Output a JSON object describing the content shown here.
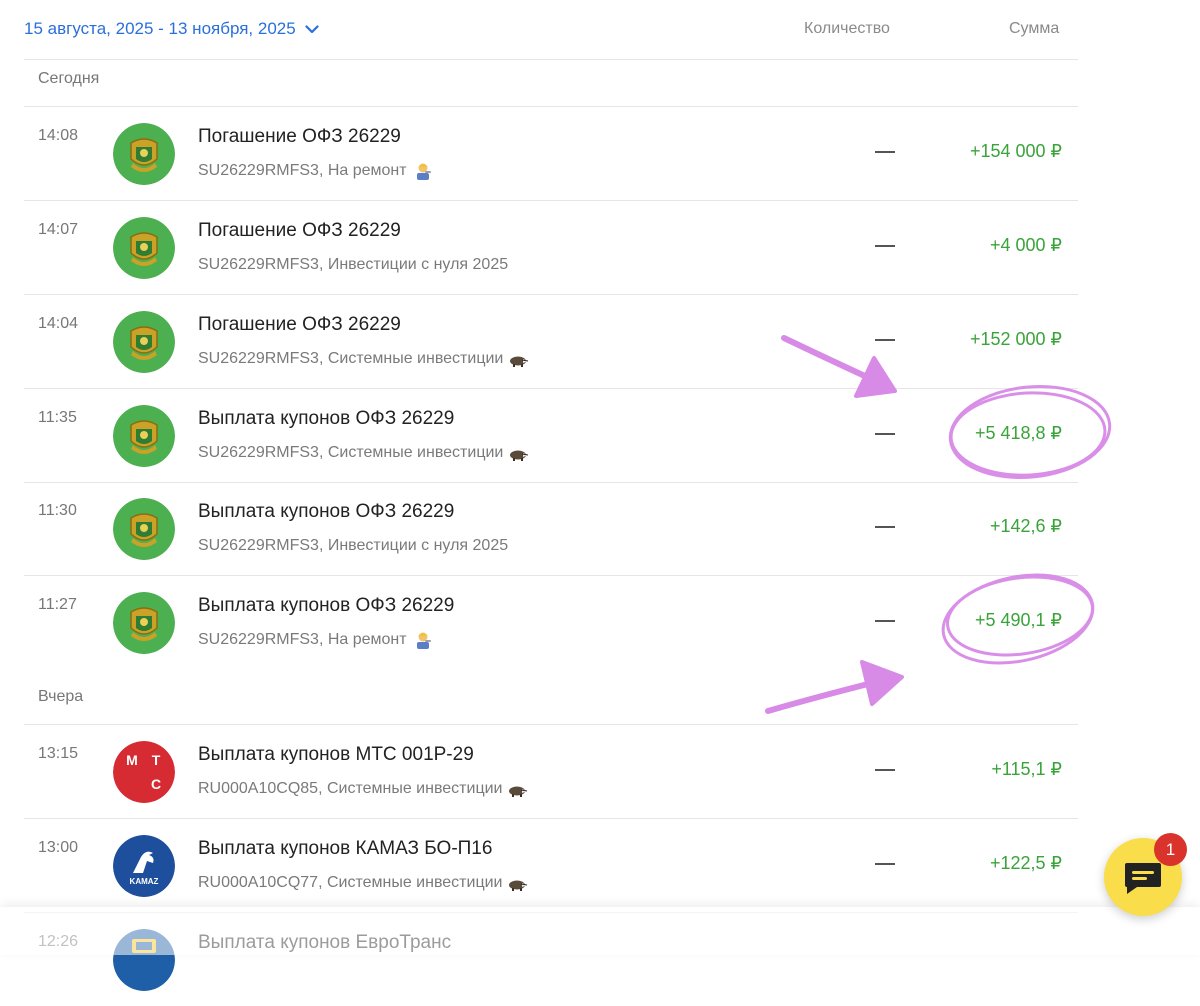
{
  "header": {
    "period": "15 августа, 2025 - 13 ноября, 2025",
    "col_quantity": "Количество",
    "col_sum": "Сумма"
  },
  "sections": [
    {
      "label": "Сегодня",
      "rows": [
        {
          "time": "14:08",
          "title": "Погашение ОФЗ 26229",
          "subtitle": "SU26229RMFS3, На ремонт",
          "emoji": "mechanic-emoji",
          "quantity": "—",
          "amount": "+154 000 ₽",
          "logo": "ofz-coat-of-arms-icon"
        },
        {
          "time": "14:07",
          "title": "Погашение ОФЗ 26229",
          "subtitle": "SU26229RMFS3, Инвестиции с нуля 2025",
          "emoji": "",
          "quantity": "—",
          "amount": "+4 000 ₽",
          "logo": "ofz-coat-of-arms-icon"
        },
        {
          "time": "14:04",
          "title": "Погашение ОФЗ 26229",
          "subtitle": "SU26229RMFS3, Системные инвестиции",
          "emoji": "badger-emoji",
          "quantity": "—",
          "amount": "+152 000 ₽",
          "logo": "ofz-coat-of-arms-icon"
        },
        {
          "time": "11:35",
          "title": "Выплата купонов ОФЗ 26229",
          "subtitle": "SU26229RMFS3, Системные инвестиции",
          "emoji": "badger-emoji",
          "quantity": "—",
          "amount": "+5 418,8 ₽",
          "logo": "ofz-coat-of-arms-icon"
        },
        {
          "time": "11:30",
          "title": "Выплата купонов ОФЗ 26229",
          "subtitle": "SU26229RMFS3, Инвестиции с нуля 2025",
          "emoji": "",
          "quantity": "—",
          "amount": "+142,6 ₽",
          "logo": "ofz-coat-of-arms-icon"
        },
        {
          "time": "11:27",
          "title": "Выплата купонов ОФЗ 26229",
          "subtitle": "SU26229RMFS3, На ремонт",
          "emoji": "mechanic-emoji",
          "quantity": "—",
          "amount": "+5 490,1 ₽",
          "logo": "ofz-coat-of-arms-icon"
        }
      ]
    },
    {
      "label": "Вчера",
      "rows": [
        {
          "time": "13:15",
          "title": "Выплата купонов МТС 001P-29",
          "subtitle": "RU000A10CQ85, Системные инвестиции",
          "emoji": "badger-emoji",
          "quantity": "—",
          "amount": "+115,1 ₽",
          "logo": "mts-logo-icon",
          "logo_text": [
            "М",
            "Т",
            "С"
          ]
        },
        {
          "time": "13:00",
          "title": "Выплата купонов КАМАЗ БО-П16",
          "subtitle": "RU000A10CQ77, Системные инвестиции",
          "emoji": "badger-emoji",
          "quantity": "—",
          "amount": "+122,5 ₽",
          "logo": "kamaz-logo-icon",
          "logo_text": "KAMAZ"
        },
        {
          "time": "12:26",
          "title": "Выплата купонов ЕвроТранс",
          "subtitle": "",
          "emoji": "",
          "quantity": "",
          "amount": "",
          "logo": "eurotrans-logo-icon"
        }
      ]
    }
  ],
  "chat": {
    "badge_count": "1"
  },
  "colors": {
    "accent": "#2a6fdb",
    "positive_amount": "#3aa33a",
    "ofz_logo_bg": "#4caf50",
    "mts_logo_bg": "#d62b33",
    "kamaz_logo_bg": "#1e4f9c",
    "chat_button": "#f9dd4a",
    "badge": "#d9332b",
    "annotation": "#d78ae6"
  }
}
